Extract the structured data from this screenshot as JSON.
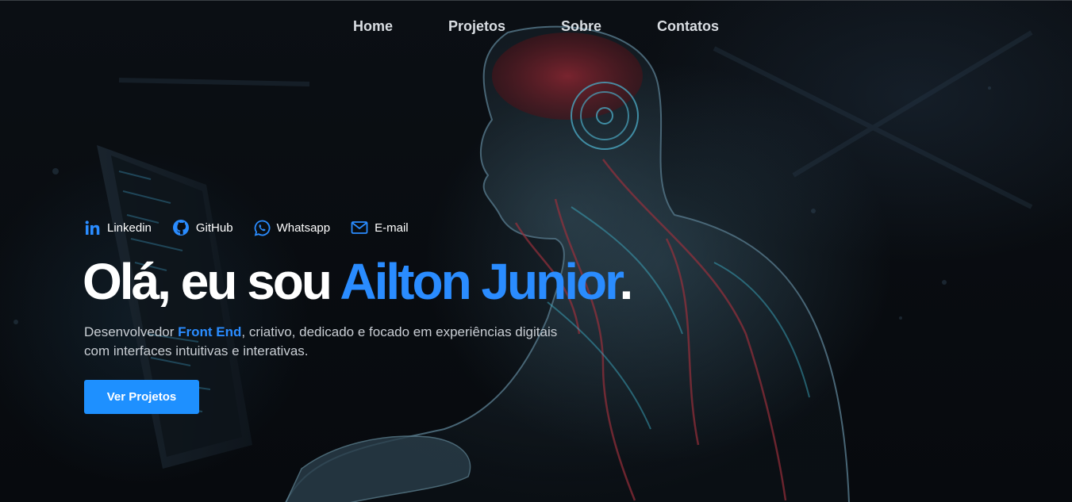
{
  "nav": {
    "items": [
      {
        "label": "Home"
      },
      {
        "label": "Projetos"
      },
      {
        "label": "Sobre"
      },
      {
        "label": "Contatos"
      }
    ]
  },
  "socials": [
    {
      "label": "Linkedin",
      "icon": "linkedin-icon"
    },
    {
      "label": "GitHub",
      "icon": "github-icon"
    },
    {
      "label": "Whatsapp",
      "icon": "whatsapp-icon"
    },
    {
      "label": "E-mail",
      "icon": "mail-icon"
    }
  ],
  "hero": {
    "greeting": "Olá, eu sou ",
    "name": "Ailton Junior",
    "period": ".",
    "desc_before": "Desenvolvedor ",
    "desc_highlight": "Front End",
    "desc_after": ", criativo, dedicado e focado em experiências digitais com interfaces intuitivas e interativas.",
    "cta_label": "Ver Projetos"
  },
  "colors": {
    "accent": "#2a8cff",
    "button": "#1e90ff",
    "background": "#0a0d12"
  }
}
